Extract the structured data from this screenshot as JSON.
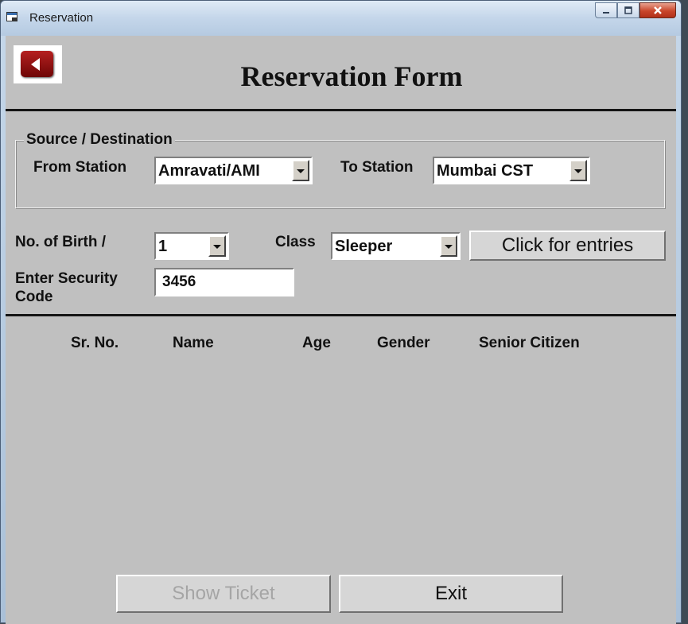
{
  "window": {
    "title": "Reservation",
    "min_icon": "minimize-icon",
    "max_icon": "maximize-icon",
    "close_icon": "close-icon"
  },
  "form": {
    "title": "Reservation Form",
    "back_icon": "back-arrow-icon"
  },
  "source_destination": {
    "legend": "Source / Destination",
    "from_label": "From Station",
    "from_value": "Amravati/AMI",
    "to_label": "To Station",
    "to_value": "Mumbai CST"
  },
  "booking": {
    "berth_label": "No. of Birth /",
    "berth_value": "1",
    "class_label": "Class",
    "class_value": "Sleeper",
    "entries_button": "Click for entries",
    "security_label_line1": "Enter  Security",
    "security_label_line2": "Code",
    "security_value": "3456"
  },
  "passenger_table": {
    "columns": [
      "Sr. No.",
      "Name",
      "Age",
      "Gender",
      "Senior Citizen"
    ]
  },
  "actions": {
    "show_ticket": "Show Ticket",
    "show_ticket_enabled": false,
    "exit": "Exit"
  },
  "colors": {
    "form_background": "#c0c0c0",
    "back_button": "#8b0a0a"
  }
}
